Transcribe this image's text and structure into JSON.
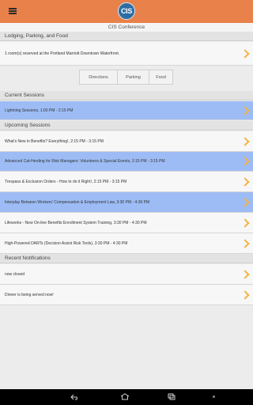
{
  "header": {
    "logo_text": "CIS",
    "subtitle": "CIS Conference"
  },
  "lodging": {
    "title": "Lodging, Parking, and Food",
    "item": "1 room(s) reserved at the Portland Marriott Downtown Waterfront.",
    "buttons": [
      "Directions",
      "Parking",
      "Food"
    ]
  },
  "current": {
    "title": "Current Sessions",
    "items": [
      "Lightning Sessions, 1:00 PM - 2:15 PM"
    ]
  },
  "upcoming": {
    "title": "Upcoming Sessions",
    "items": [
      "What's New in Benefits? Everything!, 2:15 PM - 3:15 PM",
      "Advanced Cat-Herding for Risk Managers: Volunteers & Special Events, 2:15 PM - 3:15 PM",
      "Trespass & Exclusion Orders - How to do it Right!, 2:15 PM - 3:15 PM",
      "Interplay Between Workers' Compensation & Employment Law, 3:30 PM - 4:30 PM",
      "Lifeworks - New On-line Benefits Enrollment System Training, 3:30 PM - 4:30 PM",
      "High-Powered DARTs (Decision Assist Risk Tools), 3:30 PM - 4:30 PM"
    ]
  },
  "notifications": {
    "title": "Recent Notifications",
    "items": [
      "now closed",
      "Dinner is being served now!"
    ]
  },
  "colors": {
    "topbar": "#e8814a",
    "highlight": "#9dbcf5",
    "chevron": "#f3b340"
  }
}
